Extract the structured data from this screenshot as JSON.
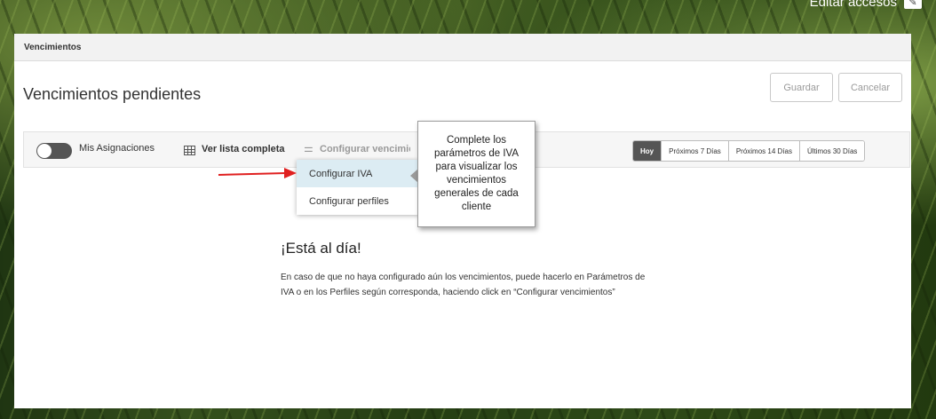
{
  "background": {
    "description": "grass-photo",
    "accent": "#3c5a1e"
  },
  "top": {
    "edit_access_label": "Editar accesos",
    "edit_icon": "edit-icon"
  },
  "panel": {
    "header_title": "Vencimientos",
    "page_title": "Vencimientos pendientes",
    "actions": {
      "save_label": "Guardar",
      "cancel_label": "Cancelar"
    }
  },
  "toolbar": {
    "toggle_label": "Mis Asignaciones",
    "toggle_on": false,
    "full_list_label": "Ver lista completa",
    "full_list_icon": "table-icon",
    "config_label": "Configurar vencimientos",
    "config_icon": "sliders-icon",
    "date_filters": [
      {
        "label": "Hoy",
        "active": true
      },
      {
        "label": "Próximos 7 Días",
        "active": false
      },
      {
        "label": "Próximos 14 Días",
        "active": false
      },
      {
        "label": "Últimos 30 Días",
        "active": false
      }
    ]
  },
  "dropdown": {
    "items": [
      {
        "label": "Configurar IVA",
        "selected": true
      },
      {
        "label": "Configurar perfiles",
        "selected": false
      }
    ]
  },
  "tooltip": {
    "text": "Complete los parámetros de IVA para visualizar los vencimientos generales de cada cliente"
  },
  "empty_state": {
    "title": "¡Está al día!",
    "text": "En caso de que no haya configurado aún los vencimientos, puede hacerlo en Parámetros de IVA o en los Perfiles según corresponda, haciendo click en “Configurar vencimientos”"
  },
  "colors": {
    "active_filter": "#555555",
    "highlight": "#dcecf3",
    "annotation_arrow": "#e02020"
  }
}
